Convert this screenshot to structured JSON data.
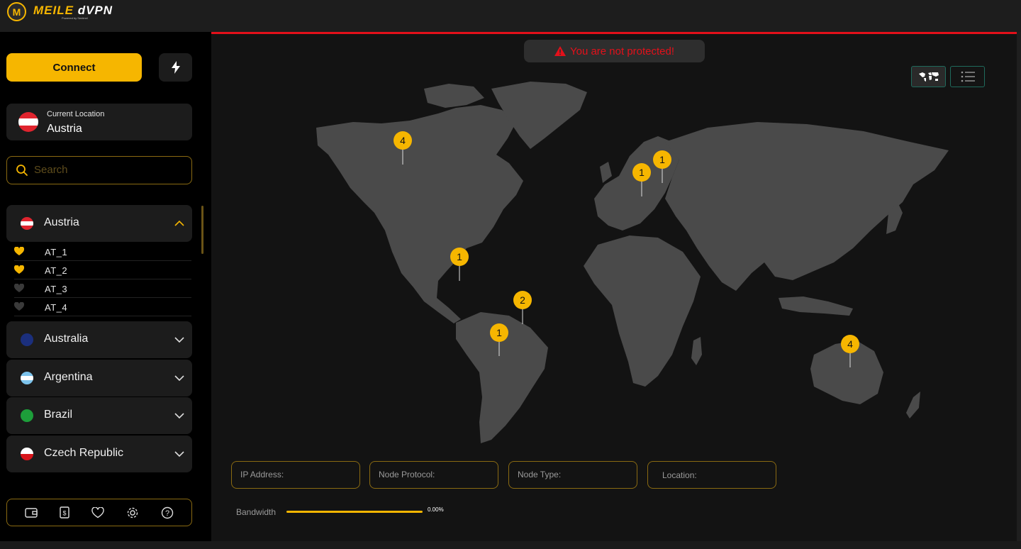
{
  "app": {
    "logo_letter": "M",
    "title_left": "MEILE",
    "title_right": "dVPN",
    "subtitle": "Powered by Sentinel"
  },
  "sidebar": {
    "connect_label": "Connect",
    "current_location": {
      "label": "Current Location",
      "value": "Austria"
    },
    "search": {
      "placeholder": "Search",
      "value": ""
    },
    "countries": [
      {
        "name": "Austria",
        "flag": "at",
        "expanded": true,
        "nodes": [
          {
            "name": "AT_1",
            "favorite": true
          },
          {
            "name": "AT_2",
            "favorite": true
          },
          {
            "name": "AT_3",
            "favorite": false
          },
          {
            "name": "AT_4",
            "favorite": false
          }
        ]
      },
      {
        "name": "Australia",
        "flag": "au",
        "expanded": false
      },
      {
        "name": "Argentina",
        "flag": "ar",
        "expanded": false
      },
      {
        "name": "Brazil",
        "flag": "br",
        "expanded": false
      },
      {
        "name": "Czech Republic",
        "flag": "cz",
        "expanded": false
      }
    ],
    "bottom_icons": [
      "wallet-icon",
      "dollar-doc-icon",
      "heart-icon",
      "gear-icon",
      "help-icon"
    ]
  },
  "main": {
    "warning": "You are not protected!",
    "view_toggle": [
      "world-map-icon",
      "list-icon"
    ],
    "map_markers": [
      {
        "region": "Canada",
        "count": "4"
      },
      {
        "region": "Germany",
        "count": "1"
      },
      {
        "region": "Finland",
        "count": "1"
      },
      {
        "region": "Mexico",
        "count": "1"
      },
      {
        "region": "Venezuela",
        "count": "2"
      },
      {
        "region": "Brazil",
        "count": "1"
      },
      {
        "region": "Australia",
        "count": "4"
      }
    ],
    "info": {
      "ip_address": "IP Address:",
      "node_protocol": "Node Protocol:",
      "node_type": "Node Type:",
      "location": "Location:"
    },
    "bandwidth": {
      "label": "Bandwidth",
      "value": "0.00%"
    }
  },
  "colors": {
    "accent": "#f6b600",
    "danger": "#e3101a",
    "teal": "#1f6a5c",
    "land": "#4a4a4a"
  }
}
